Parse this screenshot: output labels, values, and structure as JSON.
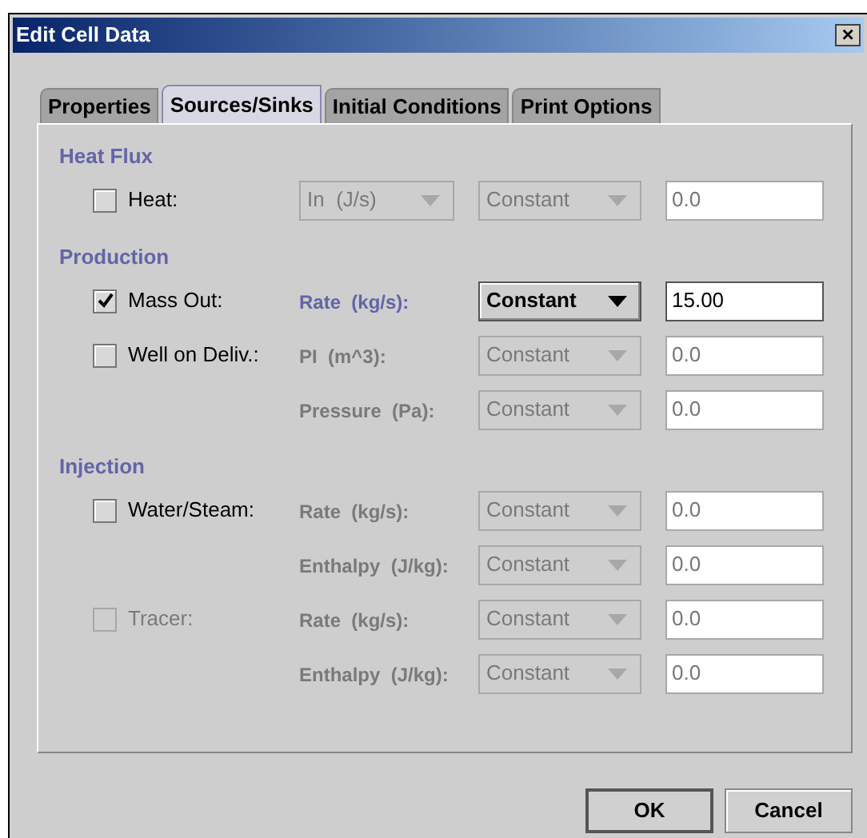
{
  "window": {
    "title": "Edit Cell Data",
    "close": "×"
  },
  "tabs": [
    {
      "label": "Properties",
      "selected": false
    },
    {
      "label": "Sources/Sinks",
      "selected": true
    },
    {
      "label": "Initial Conditions",
      "selected": false
    },
    {
      "label": "Print Options",
      "selected": false
    }
  ],
  "sections": [
    {
      "title": "Heat Flux",
      "rows": [
        {
          "checkbox": {
            "label": "Heat:",
            "checked": false,
            "disabled": false
          },
          "param": {
            "kind": "select",
            "label": "In  (J/s)",
            "disabled": true
          },
          "dropdown": {
            "value": "Constant",
            "disabled": true
          },
          "field": {
            "value": "0.0",
            "disabled": true
          }
        }
      ]
    },
    {
      "title": "Production",
      "rows": [
        {
          "checkbox": {
            "label": "Mass Out:",
            "checked": true,
            "disabled": false
          },
          "param": {
            "kind": "label",
            "label": "Rate  (kg/s):",
            "disabled": false
          },
          "dropdown": {
            "value": "Constant",
            "disabled": false
          },
          "field": {
            "value": "15.00",
            "disabled": false
          }
        },
        {
          "checkbox": {
            "label": "Well on Deliv.:",
            "checked": false,
            "disabled": false
          },
          "param": {
            "kind": "label",
            "label": "PI  (m^3):",
            "disabled": true
          },
          "dropdown": {
            "value": "Constant",
            "disabled": true
          },
          "field": {
            "value": "0.0",
            "disabled": true
          }
        },
        {
          "param": {
            "kind": "label",
            "label": "Pressure  (Pa):",
            "disabled": true
          },
          "dropdown": {
            "value": "Constant",
            "disabled": true
          },
          "field": {
            "value": "0.0",
            "disabled": true
          }
        }
      ]
    },
    {
      "title": "Injection",
      "rows": [
        {
          "checkbox": {
            "label": "Water/Steam:",
            "checked": false,
            "disabled": false
          },
          "param": {
            "kind": "label",
            "label": "Rate  (kg/s):",
            "disabled": true
          },
          "dropdown": {
            "value": "Constant",
            "disabled": true
          },
          "field": {
            "value": "0.0",
            "disabled": true
          }
        },
        {
          "param": {
            "kind": "label",
            "label": "Enthalpy  (J/kg):",
            "disabled": true
          },
          "dropdown": {
            "value": "Constant",
            "disabled": true
          },
          "field": {
            "value": "0.0",
            "disabled": true
          }
        },
        {
          "checkbox": {
            "label": "Tracer:",
            "checked": false,
            "disabled": true
          },
          "param": {
            "kind": "label",
            "label": "Rate  (kg/s):",
            "disabled": true
          },
          "dropdown": {
            "value": "Constant",
            "disabled": true
          },
          "field": {
            "value": "0.0",
            "disabled": true
          }
        },
        {
          "param": {
            "kind": "label",
            "label": "Enthalpy  (J/kg):",
            "disabled": true
          },
          "dropdown": {
            "value": "Constant",
            "disabled": true
          },
          "field": {
            "value": "0.0",
            "disabled": true
          }
        }
      ]
    }
  ],
  "buttons": [
    {
      "label": "OK",
      "default": true
    },
    {
      "label": "Cancel",
      "default": false
    }
  ]
}
